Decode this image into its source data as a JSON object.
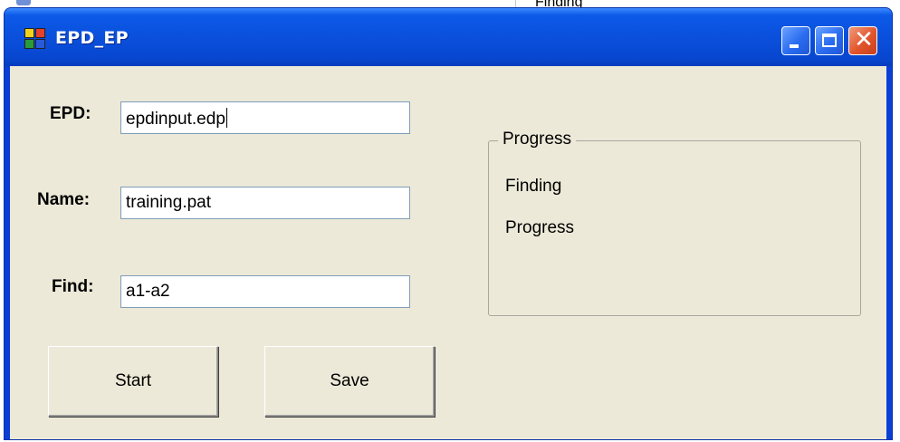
{
  "background_window": {
    "text": "Finding"
  },
  "window": {
    "title": "EPD_EP",
    "icon": "app-window-icon",
    "controls": {
      "minimize_icon": "minimize-icon",
      "maximize_icon": "maximize-icon",
      "close_icon": "close-icon",
      "close_glyph": "✕"
    }
  },
  "form": {
    "epd": {
      "label": "EPD:",
      "value": "epdinput.edp"
    },
    "name": {
      "label": "Name:",
      "value": "training.pat"
    },
    "find": {
      "label": "Find:",
      "value": "a1-a2"
    }
  },
  "buttons": {
    "start_label": "Start",
    "save_label": "Save"
  },
  "progress_group": {
    "legend": "Progress",
    "line1": "Finding",
    "line2": "Progress"
  },
  "colors": {
    "titlebar": "#0a50dc",
    "client_bg": "#ece9d8",
    "close_button": "#e2552d",
    "input_border": "#7f9db9"
  }
}
